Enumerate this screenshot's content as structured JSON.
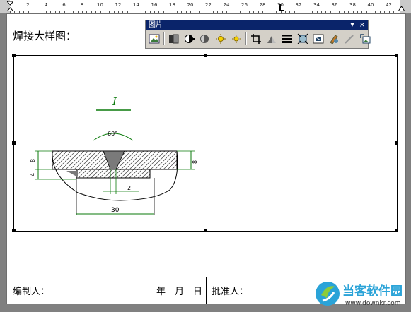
{
  "ruler": {
    "numbers": [
      "2",
      "4",
      "6",
      "8",
      "10",
      "12",
      "14",
      "16",
      "18",
      "20",
      "22",
      "24",
      "26",
      "28",
      "30",
      "32",
      "34",
      "36",
      "38",
      "40",
      "42"
    ]
  },
  "document": {
    "caption": "焊接大样图：",
    "footer": {
      "prepared_by": "编制人：",
      "date_year": "年",
      "date_month": "月",
      "date_day": "日",
      "approved_by": "批准人："
    }
  },
  "drawing": {
    "section_label": "I",
    "angle_label": "60°",
    "dim_left_top": "8",
    "dim_left_bottom": "4",
    "dim_right": "8",
    "dim_gap": "2",
    "dim_width": "30",
    "line_color": "#0a7a0a"
  },
  "toolbar": {
    "title": "图片",
    "menu_glyph": "▾",
    "close_glyph": "×",
    "buttons": [
      "insert-picture-icon",
      "color-icon",
      "more-contrast-icon",
      "less-contrast-icon",
      "more-brightness-icon",
      "less-brightness-icon",
      "crop-icon",
      "rotate-icon",
      "line-style-icon",
      "compress-icon",
      "text-wrapping-icon",
      "format-picture-icon",
      "set-transparent-color-icon",
      "reset-picture-icon"
    ]
  },
  "watermark": {
    "brand": "当客软件园",
    "url": "www.downkr.com"
  }
}
